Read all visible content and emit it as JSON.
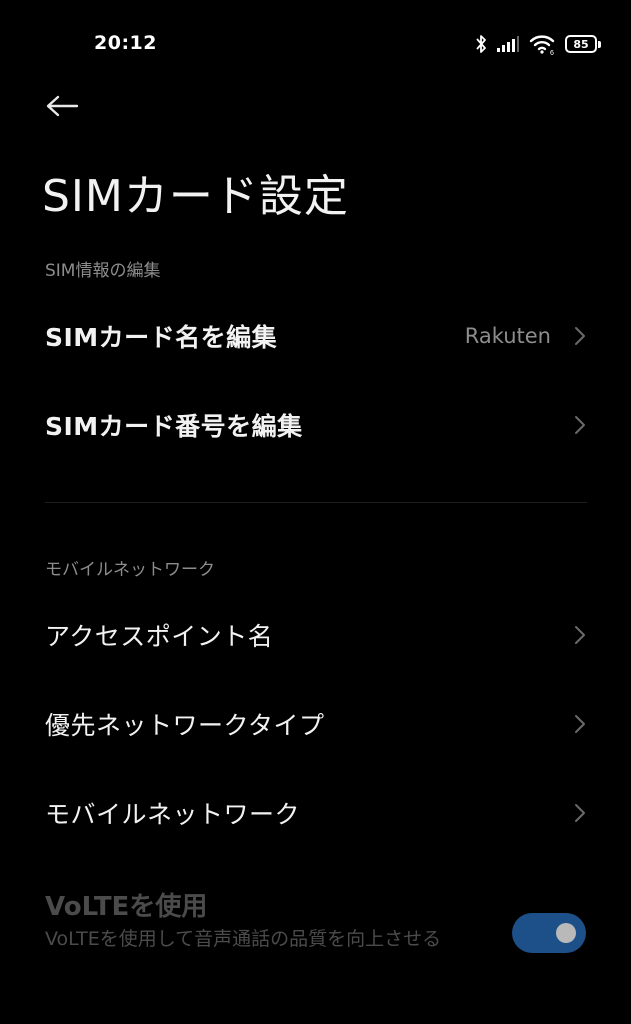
{
  "status_bar": {
    "time": "20:12",
    "battery_level": "85",
    "icons": [
      "bluetooth-icon",
      "signal-icon",
      "wifi-icon",
      "battery-icon"
    ]
  },
  "header": {
    "back_icon": "arrow-left-icon",
    "title": "SIMカード設定"
  },
  "section_sim_info": {
    "header": "SIM情報の編集",
    "items": [
      {
        "label": "SIMカード名を編集",
        "value": "Rakuten"
      },
      {
        "label": "SIMカード番号を編集",
        "value": ""
      }
    ]
  },
  "section_mobile_network": {
    "header": "モバイルネットワーク",
    "items": [
      {
        "label": "アクセスポイント名"
      },
      {
        "label": "優先ネットワークタイプ"
      },
      {
        "label": "モバイルネットワーク"
      }
    ]
  },
  "volte": {
    "title": "VoLTEを使用",
    "description": "VoLTEを使用して音声通話の品質を向上させる",
    "enabled": true
  },
  "colors": {
    "background": "#000000",
    "text_primary": "#f2f2f2",
    "text_secondary": "#8c8c8c",
    "text_disabled": "#4b4b4b",
    "toggle_on": "#1d4f88"
  }
}
